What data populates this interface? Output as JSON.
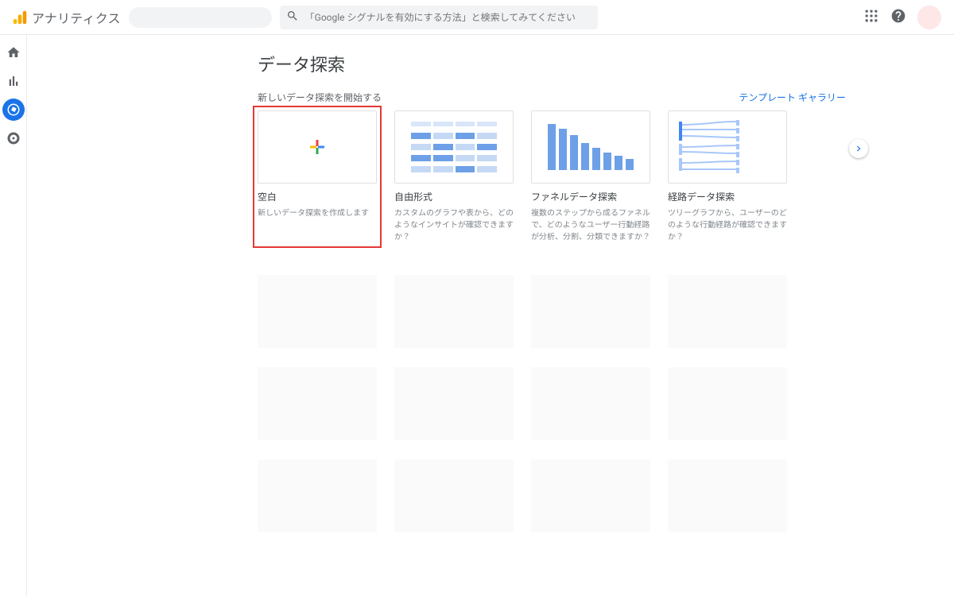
{
  "header": {
    "app_title": "アナリティクス",
    "search_placeholder": "「Google シグナルを有効にする方法」と検索してみてください"
  },
  "sidebar": {
    "items": [
      {
        "name": "home"
      },
      {
        "name": "reports"
      },
      {
        "name": "explore",
        "active": true
      },
      {
        "name": "advertising"
      }
    ]
  },
  "page": {
    "title": "データ探索",
    "section_label": "新しいデータ探索を開始する",
    "gallery_link": "テンプレート ギャラリー"
  },
  "templates": [
    {
      "title": "空白",
      "desc": "新しいデータ探索を作成します",
      "highlight": true
    },
    {
      "title": "自由形式",
      "desc": "カスタムのグラフや表から、どのようなインサイトが確認できますか？"
    },
    {
      "title": "ファネルデータ探索",
      "desc": "複数のステップから成るファネルで、どのようなユーザー行動経路が分析、分割、分類できますか？"
    },
    {
      "title": "経路データ探索",
      "desc": "ツリーグラフから、ユーザーのどのような行動経路が確認できますか？"
    }
  ]
}
